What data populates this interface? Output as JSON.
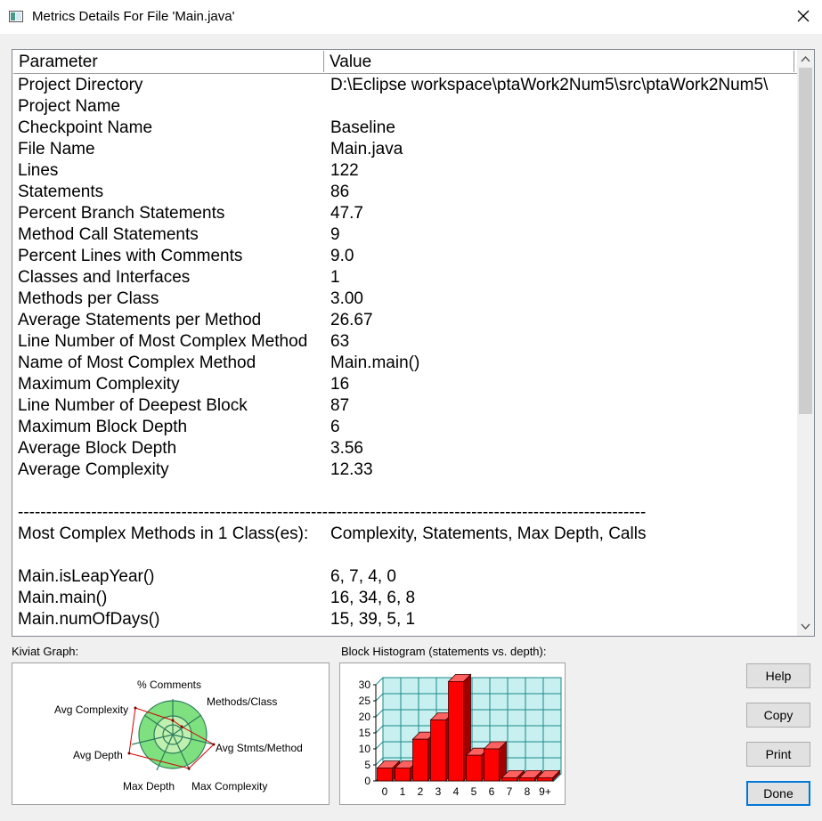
{
  "window": {
    "title": "Metrics Details For File 'Main.java'"
  },
  "table": {
    "headers": {
      "parameter": "Parameter",
      "value": "Value"
    },
    "rows": [
      {
        "p": "Project Directory",
        "v": "D:\\Eclipse workspace\\ptaWork2Num5\\src\\ptaWork2Num5\\"
      },
      {
        "p": "Project Name",
        "v": ""
      },
      {
        "p": "Checkpoint Name",
        "v": "Baseline"
      },
      {
        "p": "File Name",
        "v": "Main.java"
      },
      {
        "p": "Lines",
        "v": "122"
      },
      {
        "p": "Statements",
        "v": "86"
      },
      {
        "p": "Percent Branch Statements",
        "v": "47.7"
      },
      {
        "p": "Method Call Statements",
        "v": "9"
      },
      {
        "p": "Percent Lines with Comments",
        "v": "9.0"
      },
      {
        "p": "Classes and Interfaces",
        "v": "1"
      },
      {
        "p": "Methods per Class",
        "v": "3.00"
      },
      {
        "p": "Average Statements per Method",
        "v": "26.67"
      },
      {
        "p": "Line Number of Most Complex Method",
        "v": "63"
      },
      {
        "p": "Name of Most Complex Method",
        "v": "Main.main()"
      },
      {
        "p": "Maximum Complexity",
        "v": "16"
      },
      {
        "p": "Line Number of Deepest Block",
        "v": "87"
      },
      {
        "p": "Maximum Block Depth",
        "v": "6"
      },
      {
        "p": "Average Block Depth",
        "v": "3.56"
      },
      {
        "p": "Average Complexity",
        "v": "12.33"
      },
      {
        "p": "",
        "v": ""
      },
      {
        "p": "--------------------------------------------------------",
        "v": "--------------------------------------------------------"
      },
      {
        "p": "Most Complex Methods in 1 Class(es):",
        "v": "Complexity, Statements, Max Depth, Calls"
      },
      {
        "p": "",
        "v": ""
      },
      {
        "p": "Main.isLeapYear()",
        "v": "6, 7, 4, 0"
      },
      {
        "p": "Main.main()",
        "v": "16, 34, 6, 8"
      },
      {
        "p": "Main.numOfDays()",
        "v": "15, 39, 5, 1"
      }
    ]
  },
  "kiviat": {
    "label": "Kiviat Graph:",
    "axes": {
      "comments": "% Comments",
      "methods": "Methods/Class",
      "avg_stmts": "Avg Stmts/Method",
      "max_complexity": "Max Complexity",
      "max_depth": "Max Depth",
      "avg_depth": "Avg Depth",
      "avg_complexity": "Avg Complexity"
    },
    "colors": {
      "band": "#7fe07f",
      "inner": "#c0f0b0",
      "ring": "#2e7d5b",
      "poly": "#d00000"
    }
  },
  "histogram": {
    "label": "Block Histogram (statements vs. depth):",
    "colors": {
      "bar": "#ff0000",
      "grid": "#1a8a8a",
      "bg": "#c8f0f0"
    }
  },
  "chart_data": {
    "type": "bar",
    "categories": [
      "0",
      "1",
      "2",
      "3",
      "4",
      "5",
      "6",
      "7",
      "8",
      "9+"
    ],
    "values": [
      4,
      4,
      13,
      19,
      31,
      8,
      10,
      1,
      1,
      1
    ],
    "ylim": [
      0,
      30
    ],
    "yticks": [
      "30",
      "25",
      "20",
      "15",
      "10",
      "5",
      "0"
    ]
  },
  "buttons": {
    "help": "Help",
    "copy": "Copy",
    "print": "Print",
    "done": "Done"
  }
}
